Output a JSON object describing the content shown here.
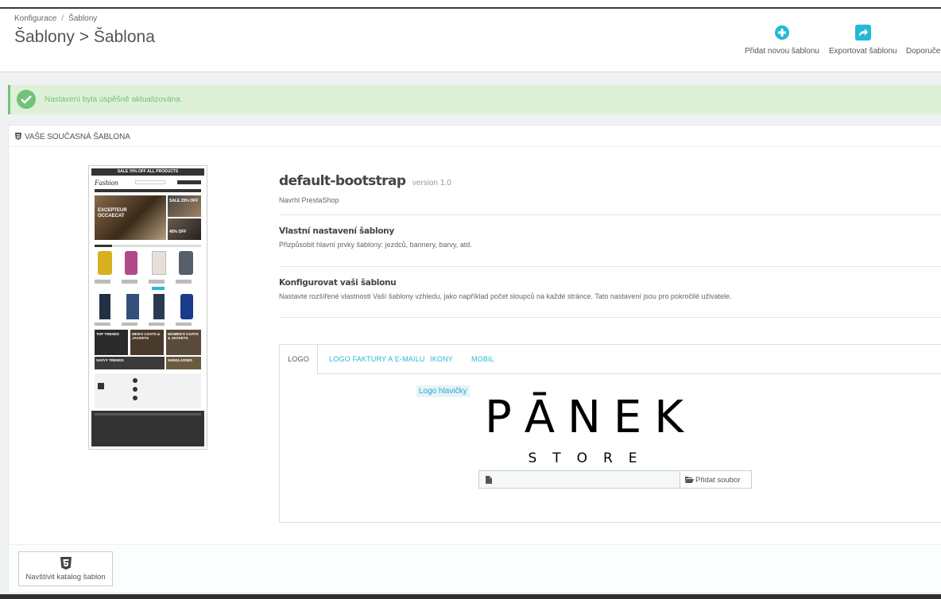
{
  "breadcrumb": {
    "parent": "Konfigurace",
    "separator": "/",
    "current": "Šablony"
  },
  "page_title": "Šablony > Šablona",
  "toolbar": {
    "add_label": "Přidat novou šablonu",
    "export_label": "Exportovat šablonu",
    "recommend_label": "Doporuče"
  },
  "alert": {
    "message": "Nastavení byla úspěšně aktualizována."
  },
  "panel": {
    "heading": "Vaše současná šablona",
    "theme_name": "default-bootstrap",
    "theme_version": "version 1.0",
    "theme_author": "Navrhl PrestaShop",
    "customize_title": "Vlastní nastavení šablony",
    "customize_desc": "Přizpůsobit hlavní prvky šablony: jezdců, bannery, barvy, atd.",
    "configure_title": "Konfigurovat vaši šablonu",
    "configure_desc": "Nastavte rozšířené vlastnosti Vaší šablony vzhledu, jako například počet sloupců na každé stránce. Tato nastavení jsou pro pokročilé uživatele."
  },
  "preview": {
    "banner": "SALE 70% OFF ALL PRODUCTS",
    "logo": "Fashion",
    "hero": "EXCEPTEUR OCCAECAT",
    "promo1": "SALE 25% OFF",
    "promo2": "45% OFF",
    "block1": "TOP TRENDS",
    "block2": "MEN'S COATS & JACKETS",
    "block3": "WOMEN'S COATS & JACKETS",
    "block4": "SAVVY TRENDS",
    "block5": "SUNGLASSES"
  },
  "tabs": [
    "Logo",
    "Logo faktury a e-mailu",
    "Ikony",
    "Mobil"
  ],
  "logo_section": {
    "label": "Logo hlavičky",
    "logo_main": "PĀNEK",
    "logo_sub": "STORE",
    "add_file_label": "Přidat soubor"
  },
  "footer": {
    "catalog_label": "Navštívit katalog šablon"
  },
  "colors": {
    "accent": "#25b9d7",
    "success": "#72c279",
    "success_bg": "#dff0d8"
  },
  "icons": {
    "add": "plus-circle-icon",
    "export": "share-icon",
    "check": "check-icon",
    "file": "file-icon",
    "folder": "folder-open-icon",
    "html5": "html5-icon"
  }
}
